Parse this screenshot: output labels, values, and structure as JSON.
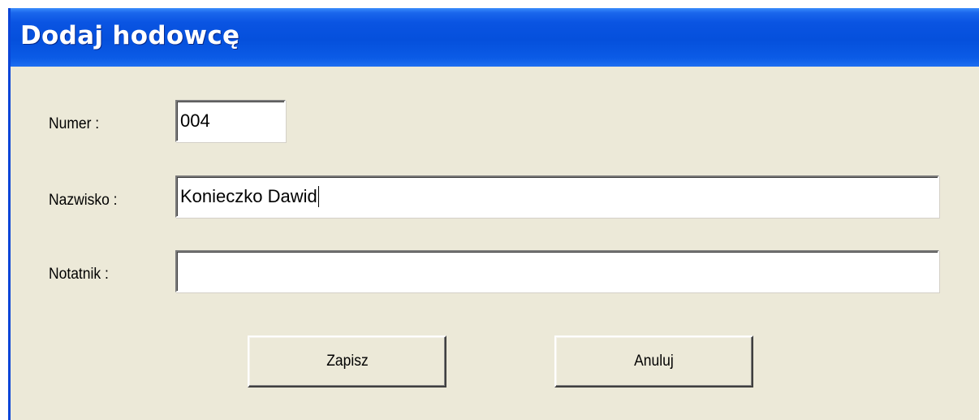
{
  "window": {
    "title": "Dodaj hodowcę"
  },
  "form": {
    "numer": {
      "label": "Numer :",
      "value": "004"
    },
    "nazwisko": {
      "label": "Nazwisko :",
      "value": "Konieczko Dawid"
    },
    "notatnik": {
      "label": "Notatnik :",
      "value": ""
    }
  },
  "buttons": {
    "save_label": "Zapisz",
    "cancel_label": "Anuluj"
  },
  "colors": {
    "title_bar": "#0550dc",
    "dialog_background": "#ece9d8",
    "field_background": "#ffffff"
  }
}
